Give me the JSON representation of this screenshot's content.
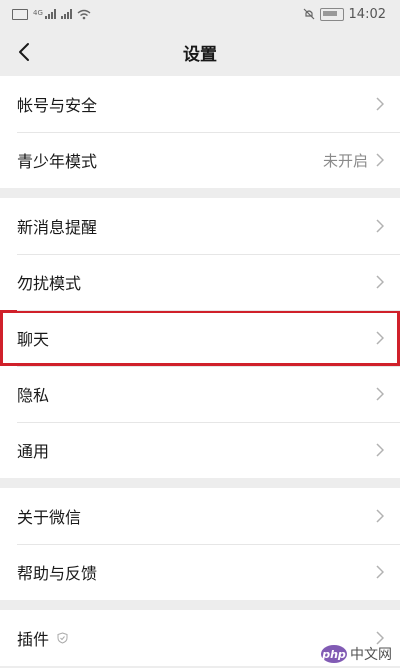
{
  "status_bar": {
    "time": "14:02",
    "icons": [
      "sim-icon",
      "signal-icon",
      "wifi-icon",
      "mute-icon",
      "battery-icon"
    ],
    "network_tag": "4G"
  },
  "nav": {
    "title": "设置",
    "back_icon": "chevron-left-icon"
  },
  "groups": [
    {
      "items": [
        {
          "label": "帐号与安全",
          "value": ""
        },
        {
          "label": "青少年模式",
          "value": "未开启"
        }
      ]
    },
    {
      "items": [
        {
          "label": "新消息提醒",
          "value": ""
        },
        {
          "label": "勿扰模式",
          "value": ""
        },
        {
          "label": "聊天",
          "value": "",
          "highlighted": true
        },
        {
          "label": "隐私",
          "value": ""
        },
        {
          "label": "通用",
          "value": ""
        }
      ]
    },
    {
      "items": [
        {
          "label": "关于微信",
          "value": ""
        },
        {
          "label": "帮助与反馈",
          "value": ""
        }
      ]
    },
    {
      "items": [
        {
          "label": "插件",
          "value": "",
          "icon": "shield-icon"
        }
      ]
    }
  ],
  "watermark": {
    "logo": "php",
    "text": "中文网"
  },
  "colors": {
    "background": "#ededed",
    "highlight": "#d0202a",
    "value_text": "#8a8a8a"
  }
}
